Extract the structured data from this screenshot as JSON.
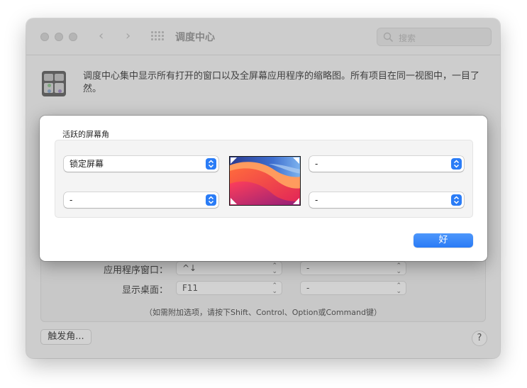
{
  "window": {
    "title": "调度中心",
    "search_placeholder": "搜索",
    "intro_text": "调度中心集中显示所有打开的窗口以及全屏幕应用程序的缩略图。所有项目在同一视图中，一目了然。"
  },
  "shortcuts": {
    "rows": [
      {
        "label": "应用程序窗口：",
        "key": "^↓",
        "modifier": "-"
      },
      {
        "label": "显示桌面：",
        "key": "F11",
        "modifier": "-"
      }
    ],
    "hint": "（如需附加选项，请按下Shift、Control、Option或Command键）"
  },
  "footer": {
    "hot_corners_button": "触发角...",
    "help_button": "?"
  },
  "hot_corners_sheet": {
    "title": "活跃的屏幕角",
    "top_left": "锁定屏幕",
    "top_right": "-",
    "bottom_left": "-",
    "bottom_right": "-",
    "ok_button": "好"
  },
  "colors": {
    "accent": "#2a7bf6"
  }
}
